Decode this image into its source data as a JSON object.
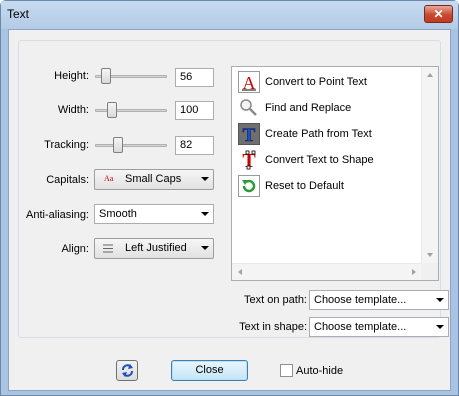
{
  "window": {
    "title": "Text",
    "close_glyph": "✕"
  },
  "controls": {
    "height": {
      "label": "Height:",
      "value": "56",
      "level": 0.1
    },
    "width": {
      "label": "Width:",
      "value": "100",
      "level": 0.22
    },
    "tracking": {
      "label": "Tracking:",
      "value": "82",
      "level": 0.3
    },
    "capitals": {
      "label": "Capitals:",
      "icon_text": "Aa",
      "value": "Small Caps"
    },
    "antialiasing": {
      "label": "Anti-aliasing:",
      "value": "Smooth"
    },
    "align": {
      "label": "Align:",
      "value": "Left Justified"
    }
  },
  "actions": [
    {
      "label": "Convert to Point Text",
      "icon": "point-text-icon"
    },
    {
      "label": "Find and Replace",
      "icon": "magnifier-icon"
    },
    {
      "label": "Create Path from Text",
      "icon": "path-text-icon"
    },
    {
      "label": "Convert Text to Shape",
      "icon": "text-to-shape-icon"
    },
    {
      "label": "Reset to Default",
      "icon": "reset-icon"
    }
  ],
  "templates": {
    "text_on_path": {
      "label": "Text on path:",
      "value": "Choose template..."
    },
    "text_in_shape": {
      "label": "Text in shape:",
      "value": "Choose template..."
    }
  },
  "footer": {
    "refresh_icon": "refresh-icon",
    "close_label": "Close",
    "autohide_label": "Auto-hide",
    "autohide_checked": false
  },
  "colors": {
    "accent_red": "#cc0000",
    "accent_blue": "#1f4fbf",
    "accent_green": "#2e9a3a"
  }
}
